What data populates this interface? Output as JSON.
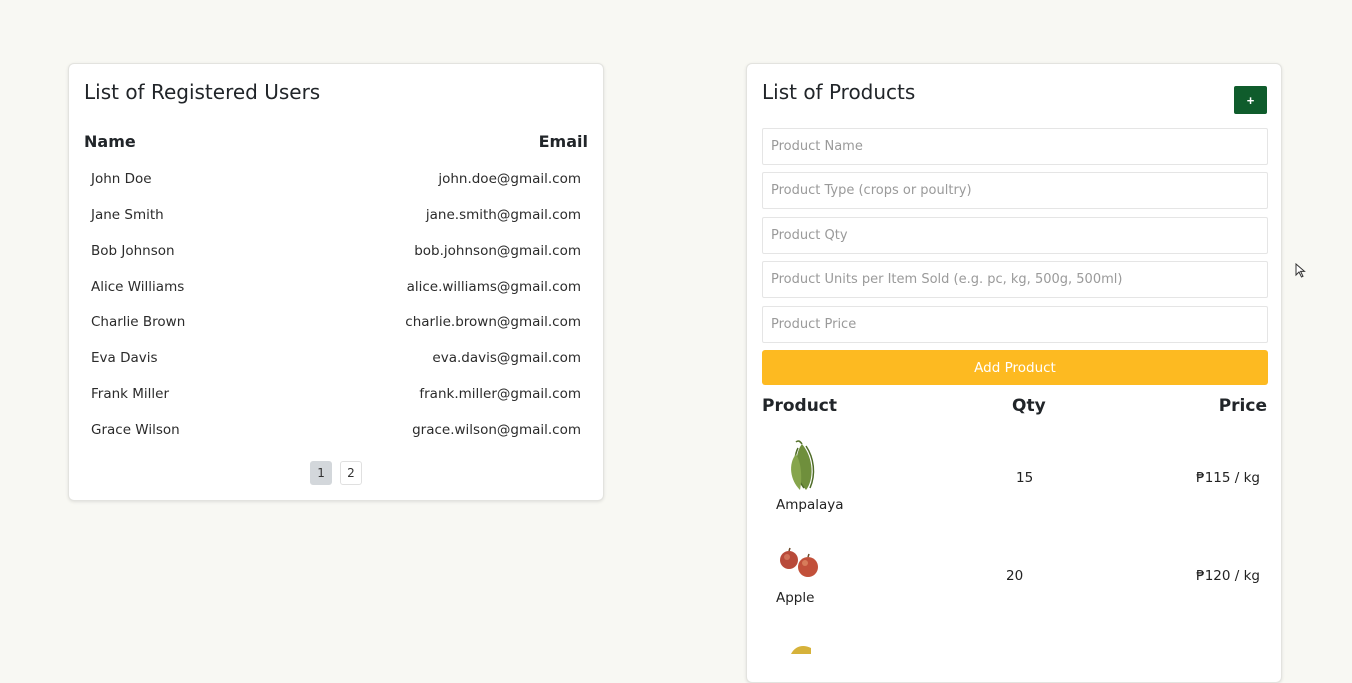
{
  "users": {
    "title": "List of Registered Users",
    "columns": {
      "name": "Name",
      "email": "Email"
    },
    "rows": [
      {
        "name": "John Doe",
        "email": "john.doe@gmail.com"
      },
      {
        "name": "Jane Smith",
        "email": "jane.smith@gmail.com"
      },
      {
        "name": "Bob Johnson",
        "email": "bob.johnson@gmail.com"
      },
      {
        "name": "Alice Williams",
        "email": "alice.williams@gmail.com"
      },
      {
        "name": "Charlie Brown",
        "email": "charlie.brown@gmail.com"
      },
      {
        "name": "Eva Davis",
        "email": "eva.davis@gmail.com"
      },
      {
        "name": "Frank Miller",
        "email": "frank.miller@gmail.com"
      },
      {
        "name": "Grace Wilson",
        "email": "grace.wilson@gmail.com"
      }
    ],
    "pagination": {
      "pages": [
        "1",
        "2"
      ],
      "current": "1"
    }
  },
  "products": {
    "title": "List of Products",
    "add_icon_label": "+",
    "form": {
      "name_placeholder": "Product Name",
      "type_placeholder": "Product Type (crops or poultry)",
      "qty_placeholder": "Product Qty",
      "units_placeholder": "Product Units per Item Sold (e.g. pc, kg, 500g, 500ml)",
      "price_placeholder": "Product Price",
      "submit_label": "Add Product"
    },
    "columns": {
      "product": "Product",
      "qty": "Qty",
      "price": "Price"
    },
    "rows": [
      {
        "name": "Ampalaya",
        "qty": "15",
        "price": "₱115 / kg",
        "image": "ampalaya-image"
      },
      {
        "name": "Apple",
        "qty": "20",
        "price": "₱120 / kg",
        "image": "apple-image"
      }
    ]
  },
  "colors": {
    "page_bg": "#f8f8f3",
    "add_icon_bg": "#0f5c2c",
    "add_button_bg": "#fdba21",
    "active_page_bg": "#d3d7db"
  }
}
